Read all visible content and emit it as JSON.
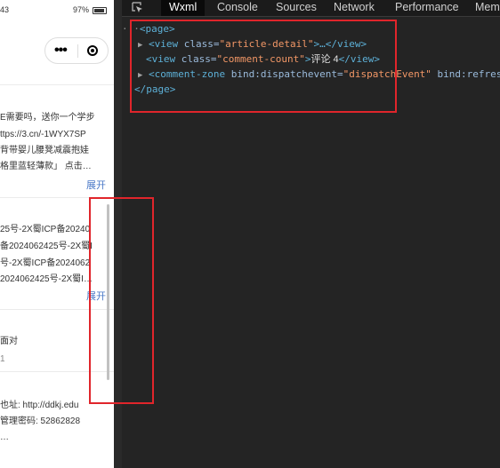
{
  "phone": {
    "status_time": "43",
    "battery_text": "97%",
    "card1_lines": [
      "E需要吗，送你一个学步",
      "ttps://3.cn/-1WYX7SP",
      "背带婴儿腰凳减震抱娃",
      "格里蓝轻薄款」 点击…"
    ],
    "expand_label": "展开",
    "card2_lines": [
      "25号-2X蜀ICP备20240",
      "备2024062425号-2X蜀I",
      "号-2X蜀ICP备2024062",
      "2024062425号-2X蜀I…"
    ],
    "card3_lines": [
      "面对",
      "1"
    ],
    "card4_lines": [
      "也址: http://ddkj.edu",
      "管理密码: 52862828",
      "…"
    ]
  },
  "devtools": {
    "tabs": [
      "Wxml",
      "Console",
      "Sources",
      "Network",
      "Performance",
      "Mem"
    ],
    "active_tab": "Wxml",
    "tree": {
      "ellipsis": "···",
      "page_open": "<page>",
      "line1_tag": "<view",
      "line1_attr": " class=",
      "line1_val": "\"article-detail\"",
      "line1_end": ">…</view>",
      "line2_tag": "<view",
      "line2_attr": " class=",
      "line2_val": "\"comment-count\"",
      "line2_close": ">",
      "line2_text": "评论 4",
      "line2_end": "</view>",
      "line3_tag": "<comment-zone",
      "line3_attr1": " bind:dispatchevent=",
      "line3_val1": "\"dispatchEvent\"",
      "line3_attr2": " bind:refresh",
      "page_close": "</page>"
    }
  },
  "colors": {
    "annotation_red": "#e0252b",
    "tag_blue": "#5db0d7",
    "value_orange": "#f29766"
  }
}
